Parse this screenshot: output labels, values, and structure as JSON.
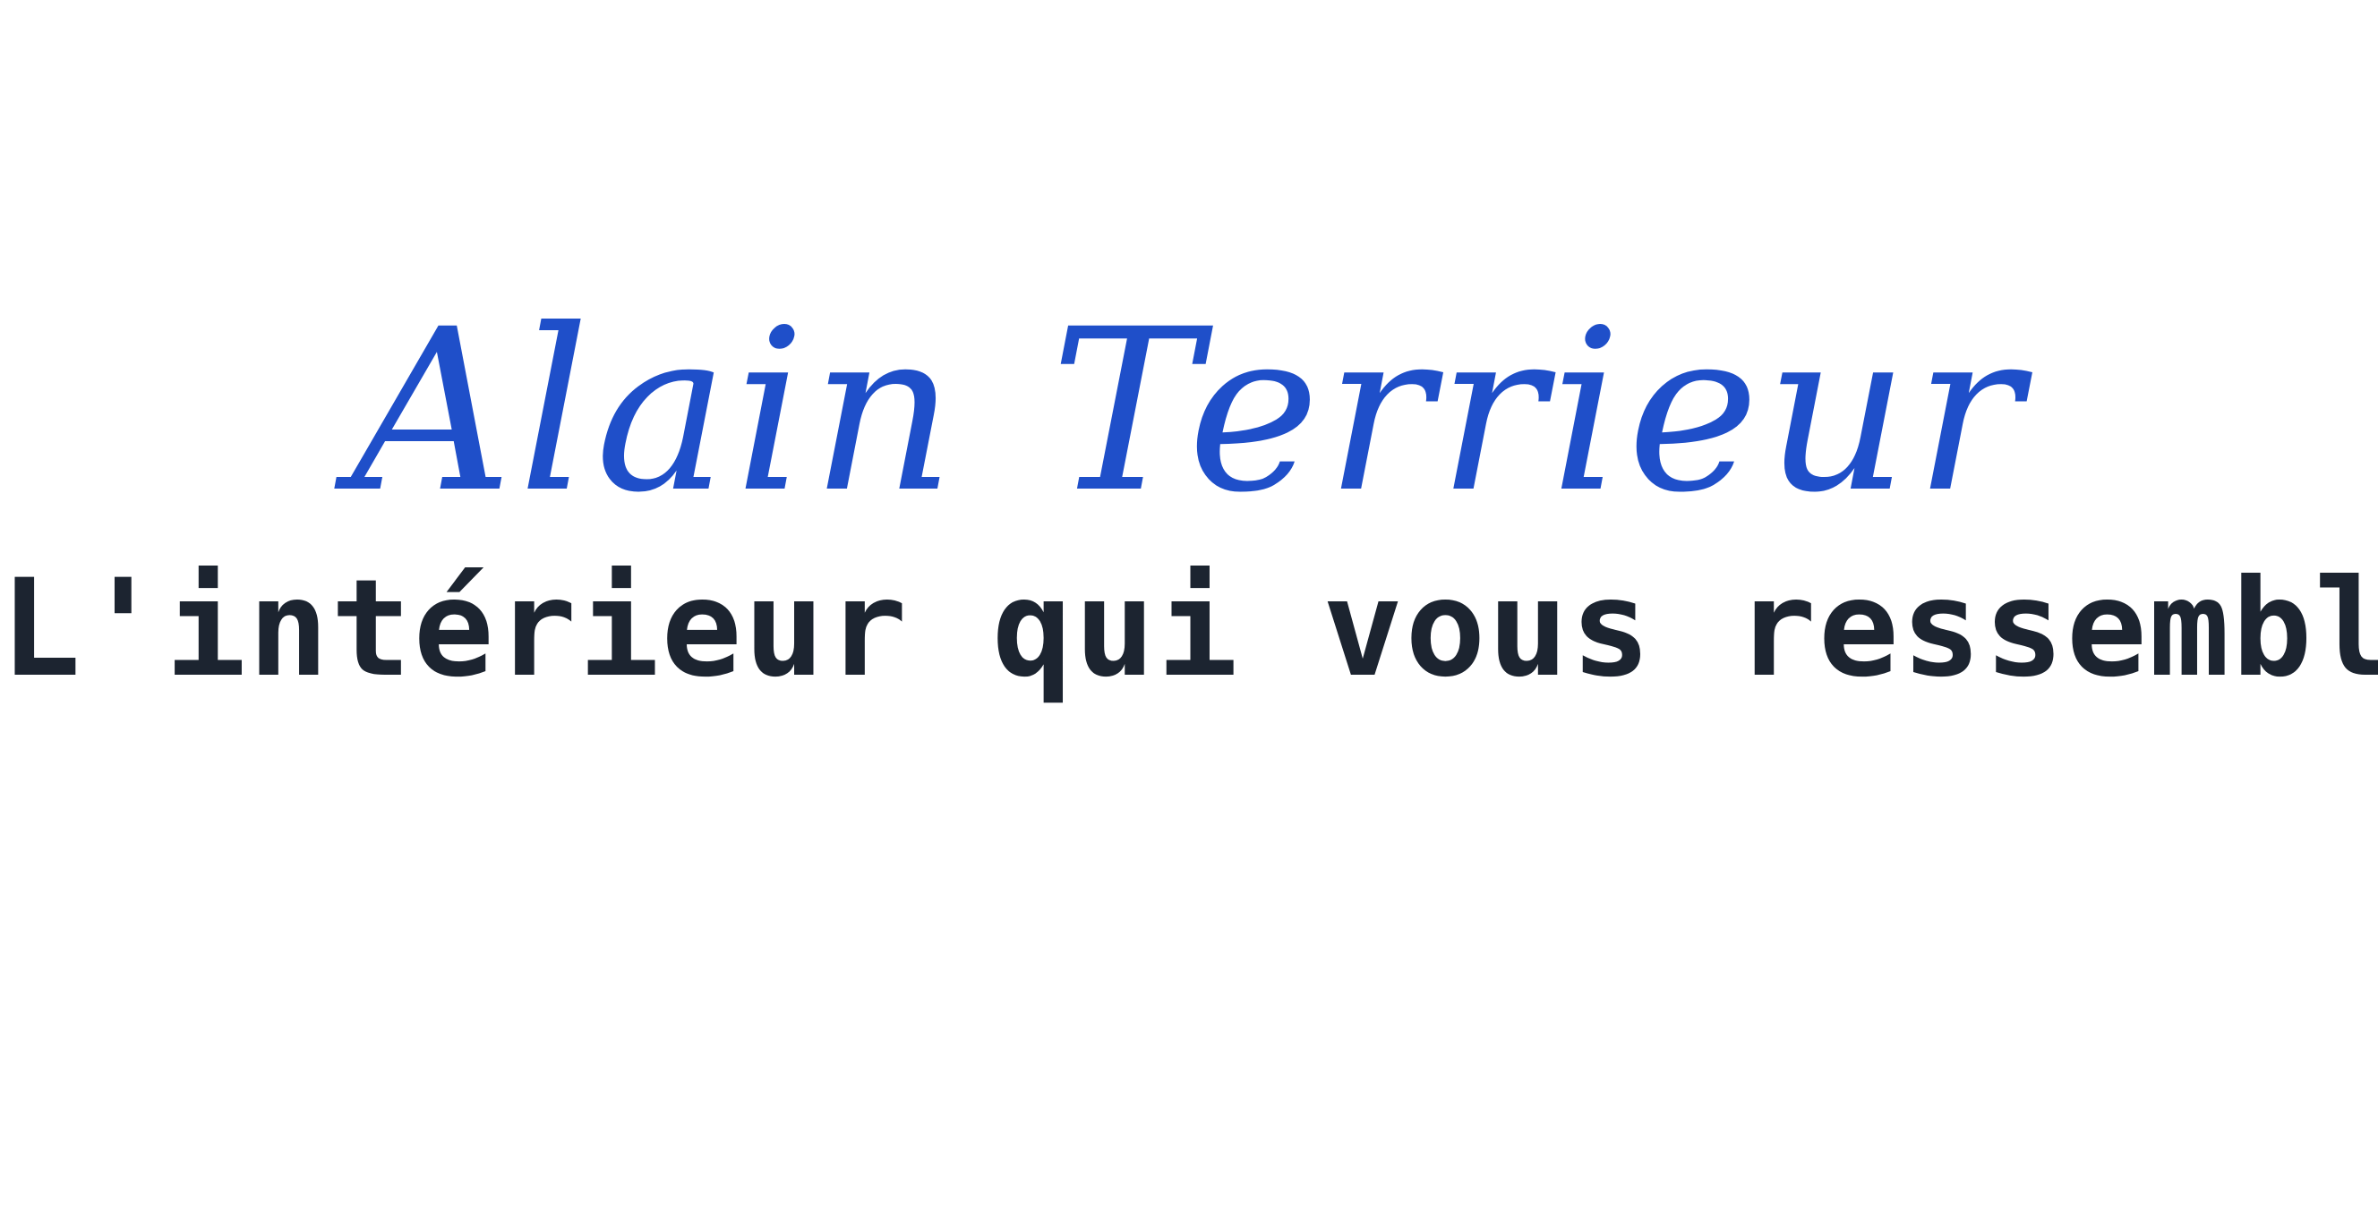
{
  "colors": {
    "background": "#ffffff",
    "brand_blue": "#1f4fc9",
    "tagline_dark": "#1c2430"
  },
  "logo": {
    "first_name": "Alain",
    "last_name": "Terrieur",
    "tagline": "L'intérieur qui vous ressemble"
  }
}
